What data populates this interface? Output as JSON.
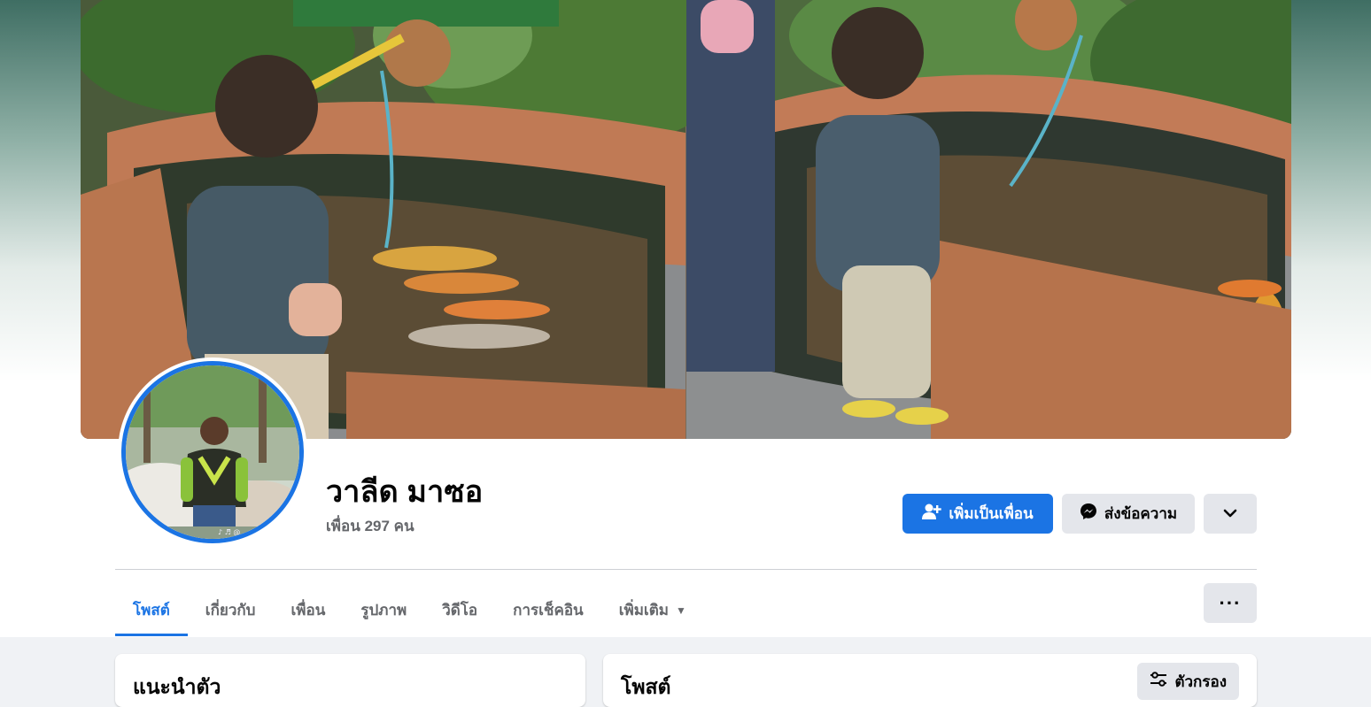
{
  "profile": {
    "name": "วาลีด มาซอ",
    "friends_count_text": "เพื่อน 297 คน"
  },
  "actions": {
    "add_friend_label": "เพิ่มเป็นเพื่อน",
    "message_label": "ส่งข้อความ",
    "dropdown_icon": "chevron-down-icon"
  },
  "tabs": [
    {
      "label": "โพสต์",
      "active": true
    },
    {
      "label": "เกี่ยวกับ",
      "active": false
    },
    {
      "label": "เพื่อน",
      "active": false
    },
    {
      "label": "รูปภาพ",
      "active": false
    },
    {
      "label": "วิดีโอ",
      "active": false
    },
    {
      "label": "การเช็คอิน",
      "active": false
    },
    {
      "label": "เพิ่มเติม",
      "active": false
    }
  ],
  "tab_more_caret": "▼",
  "tab_dots": "···",
  "cards": {
    "intro_title": "แนะนำตัว",
    "posts_title": "โพสต์",
    "filter_label": "ตัวกรอง"
  },
  "colors": {
    "accent": "#1b74e4",
    "secondary_button": "#e4e6eb",
    "page_background": "#f0f2f5",
    "muted_text": "#65676b"
  },
  "avatar_watermark": "♪ ♬ @"
}
